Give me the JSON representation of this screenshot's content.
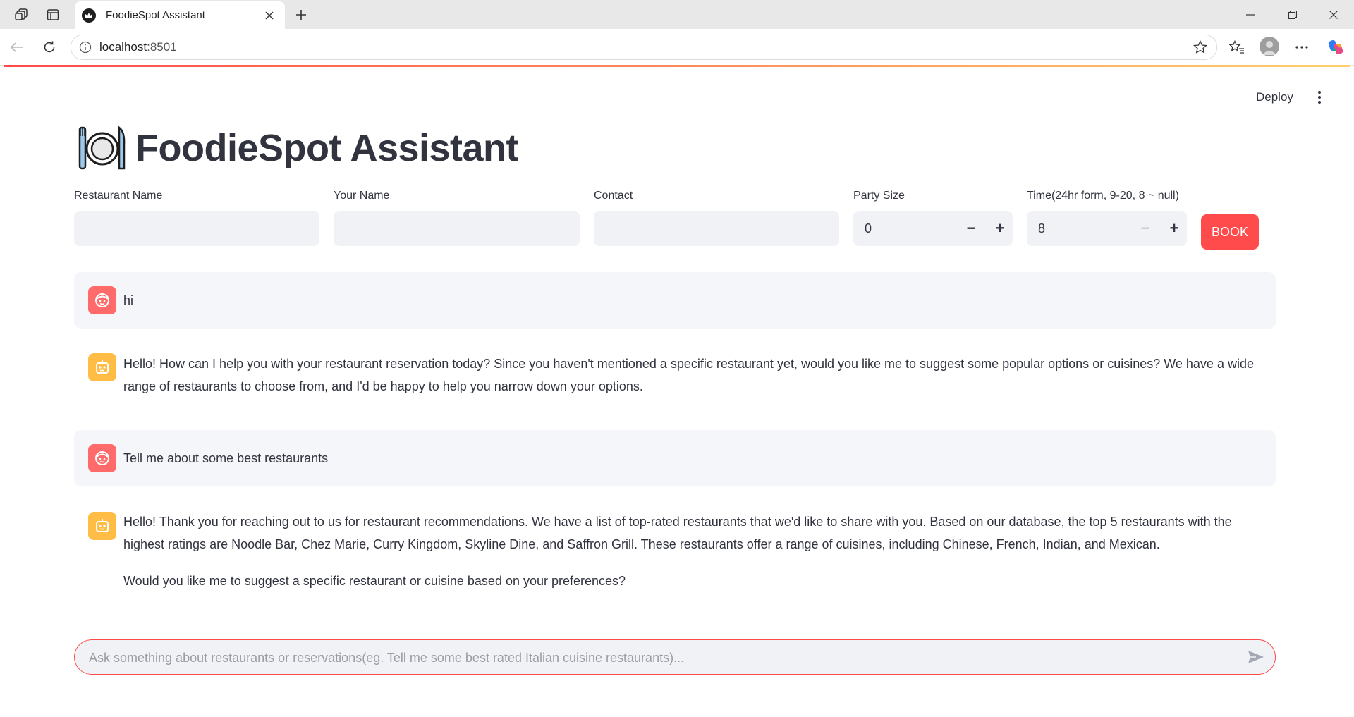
{
  "browser": {
    "tab_title": "FoodieSpot Assistant",
    "url_host": "localhost",
    "url_port": ":8501"
  },
  "app": {
    "deploy_label": "Deploy",
    "title": "FoodieSpot Assistant",
    "title_icon": "plate-cutlery-icon",
    "accent_color": "#ff4b4b",
    "form": {
      "restaurant_name": {
        "label": "Restaurant Name",
        "value": ""
      },
      "your_name": {
        "label": "Your Name",
        "value": ""
      },
      "contact": {
        "label": "Contact",
        "value": ""
      },
      "party_size": {
        "label": "Party Size",
        "value": "0"
      },
      "time": {
        "label": "Time(24hr form, 9-20, 8 ~ null)",
        "value": "8"
      },
      "book_label": "BOOK"
    },
    "messages": [
      {
        "role": "user",
        "text": "hi"
      },
      {
        "role": "assistant",
        "text": "Hello! How can I help you with your restaurant reservation today? Since you haven't mentioned a specific restaurant yet, would you like me to suggest some popular options or cuisines? We have a wide range of restaurants to choose from, and I'd be happy to help you narrow down your options."
      },
      {
        "role": "user",
        "text": "Tell me about some best restaurants"
      },
      {
        "role": "assistant",
        "text": "Hello! Thank you for reaching out to us for restaurant recommendations. We have a list of top-rated restaurants that we'd like to share with you. Based on our database, the top 5 restaurants with the highest ratings are Noodle Bar, Chez Marie, Curry Kingdom, Skyline Dine, and Saffron Grill. These restaurants offer a range of cuisines, including Chinese, French, Indian, and Mexican.",
        "text2": "Would you like me to suggest a specific restaurant or cuisine based on your preferences?"
      }
    ],
    "chat_input_placeholder": "Ask something about restaurants or reservations(eg. Tell me some best rated Italian cuisine restaurants)..."
  }
}
